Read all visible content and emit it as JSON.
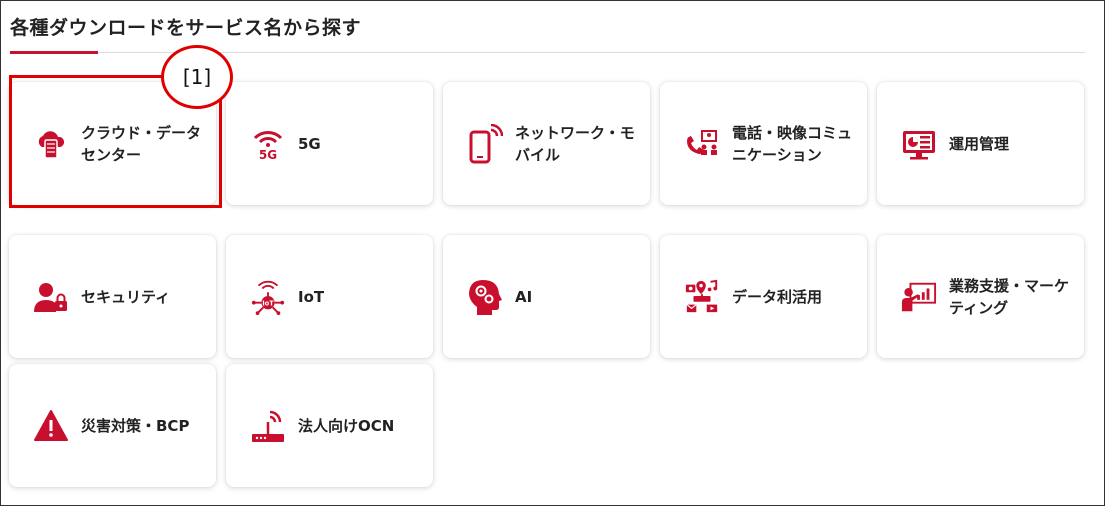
{
  "heading": "各種ダウンロードをサービス名から探す",
  "accent_color": "#c8102e",
  "annotation": {
    "marker_label": "[1]",
    "color": "#e00000"
  },
  "services": [
    {
      "label": "クラウド・データセンター",
      "icon": "cloud-server-icon"
    },
    {
      "label": "5G",
      "icon": "wifi-5g-icon"
    },
    {
      "label": "ネットワーク・モバイル",
      "icon": "smartphone-signal-icon"
    },
    {
      "label": "電話・映像コミュニケーション",
      "icon": "phone-meeting-icon"
    },
    {
      "label": "運用管理",
      "icon": "monitor-dashboard-icon"
    },
    {
      "label": "セキュリティ",
      "icon": "user-lock-icon"
    },
    {
      "label": "IoT",
      "icon": "iot-hub-icon"
    },
    {
      "label": "AI",
      "icon": "head-gears-icon"
    },
    {
      "label": "データ利活用",
      "icon": "data-media-icon"
    },
    {
      "label": "業務支援・マーケティング",
      "icon": "presentation-chart-icon"
    },
    {
      "label": "災害対策・BCP",
      "icon": "warning-triangle-icon"
    },
    {
      "label": "法人向けOCN",
      "icon": "router-signal-icon"
    }
  ]
}
